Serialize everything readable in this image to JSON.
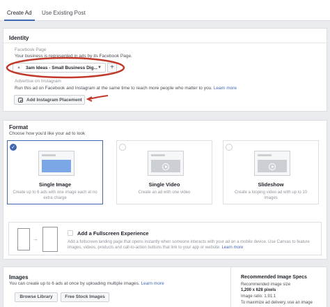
{
  "tabs": {
    "create": "Create Ad",
    "existing": "Use Existing Post"
  },
  "identity": {
    "heading": "Identity",
    "fb_page_label": "Facebook Page",
    "fb_page_help": "Your business is represented in ads by its Facebook Page.",
    "page_value": "3am Ideas - Small Business Dig...",
    "instagram_label": "Advertise on Instagram",
    "instagram_help": "Run this ad on Facebook and Instagram at the same time to reach more people who matter to you.",
    "learn_more": "Learn more",
    "add_instagram": "Add Instagram Placement"
  },
  "format": {
    "heading": "Format",
    "subtitle": "Choose how you'd like your ad to look",
    "options": [
      {
        "title": "Single Image",
        "desc": "Create up to 6 ads with one image each at no extra charge"
      },
      {
        "title": "Single Video",
        "desc": "Create an ad with one video"
      },
      {
        "title": "Slideshow",
        "desc": "Create a looping video ad with up to 10 images"
      }
    ]
  },
  "fullscreen": {
    "title": "Add a Fullscreen Experience",
    "desc": "Add a fullscreen landing page that opens instantly when someone interacts with your ad on a mobile device. Use Canvas to feature images, videos, products and call-to-action buttons that link to your app or website.",
    "learn_more": "Learn more"
  },
  "images": {
    "heading": "Images",
    "help": "You can create up to 6 ads at once by uploading multiple images.",
    "learn_more": "Learn more",
    "browse": "Browse Library",
    "stock": "Free Stock Images"
  },
  "specs": {
    "heading": "Recommended Image Specs",
    "items": [
      "Recommended image size",
      "1,200 x 628 pixels",
      "Image ratio: 1.91:1",
      "To maximize ad delivery, use an image"
    ]
  },
  "colors": {
    "accent": "#4267b2",
    "annotation": "#c0392b"
  }
}
